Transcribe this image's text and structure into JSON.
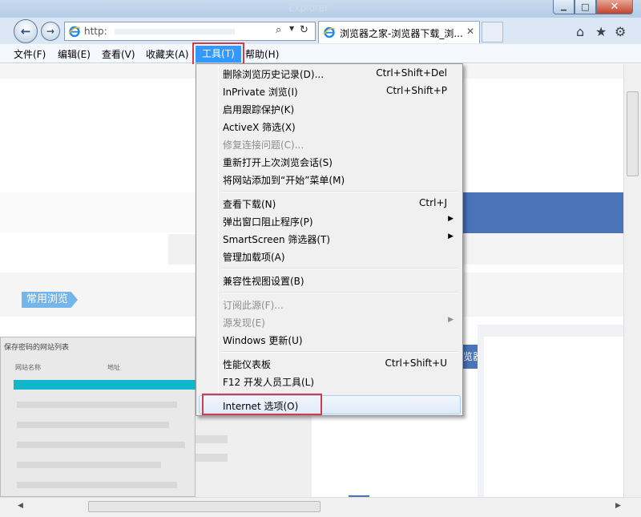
{
  "window": {
    "title": "Explorer",
    "close_glyph": "✕",
    "minimize_glyph": "▁",
    "maximize_glyph": "□"
  },
  "nav": {
    "back_glyph": "←",
    "forward_glyph": "→",
    "address_text": "http:",
    "search_glyph": "⌕",
    "dropdown_glyph": "▼",
    "refresh_glyph": "↻"
  },
  "tab": {
    "title": "浏览器之家-浏览器下载_浏...",
    "close_glyph": "✕"
  },
  "toolbar": {
    "home_glyph": "⌂",
    "favorites_glyph": "★",
    "tools_glyph": "⚙"
  },
  "menubar": {
    "file": "文件(F)",
    "edit": "编辑(E)",
    "view": "查看(V)",
    "favorites": "收藏夹(A)",
    "tools": "工具(T)",
    "help": "帮助(H)"
  },
  "tools_menu": {
    "items": [
      {
        "label": "删除浏览历史记录(D)...",
        "shortcut": "Ctrl+Shift+Del"
      },
      {
        "label": "InPrivate 浏览(I)",
        "shortcut": "Ctrl+Shift+P"
      },
      {
        "label": "启用跟踪保护(K)",
        "shortcut": ""
      },
      {
        "label": "ActiveX 筛选(X)",
        "shortcut": ""
      },
      {
        "label": "修复连接问题(C)...",
        "shortcut": ""
      },
      {
        "label": "重新打开上次浏览会话(S)",
        "shortcut": ""
      },
      {
        "label": "将网站添加到“开始”菜单(M)",
        "shortcut": ""
      },
      {
        "label": "查看下载(N)",
        "shortcut": "Ctrl+J"
      },
      {
        "label": "弹出窗口阻止程序(P)",
        "shortcut": ""
      },
      {
        "label": "SmartScreen 筛选器(T)",
        "shortcut": ""
      },
      {
        "label": "管理加载项(A)",
        "shortcut": ""
      },
      {
        "label": "兼容性视图设置(B)",
        "shortcut": ""
      },
      {
        "label": "订阅此源(F)...",
        "shortcut": ""
      },
      {
        "label": "源发现(E)",
        "shortcut": ""
      },
      {
        "label": "Windows 更新(U)",
        "shortcut": ""
      },
      {
        "label": "性能仪表板",
        "shortcut": "Ctrl+Shift+U"
      },
      {
        "label": "F12 开发人员工具(L)",
        "shortcut": ""
      },
      {
        "label": "Internet 选项(O)",
        "shortcut": ""
      }
    ],
    "submenu_glyph": "▶"
  },
  "page": {
    "section_label": "常用浏览",
    "dialog_title": "保存密码的网站列表",
    "col_site": "网站名称",
    "col_addr": "地址",
    "side_heading": "览器"
  },
  "scroll": {
    "left_glyph": "◀",
    "right_glyph": "▶"
  },
  "colors": {
    "selection_blue": "#3399ff",
    "highlight_red": "#d23b48",
    "page_blue": "#4a73b8",
    "tag_blue": "#74b6ea",
    "teal_row": "#10b7c8"
  }
}
